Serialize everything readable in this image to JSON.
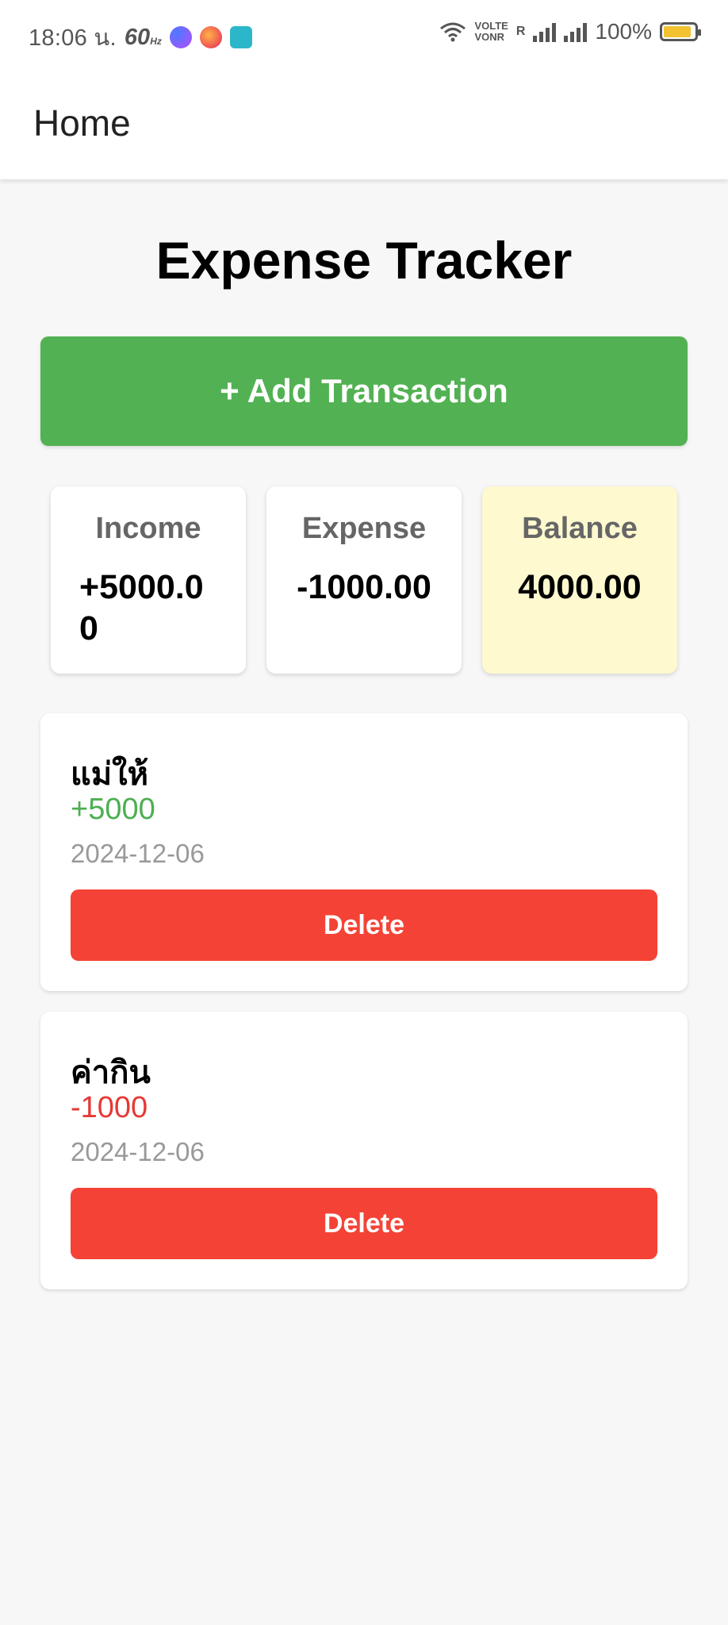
{
  "status_bar": {
    "time": "18:06 น.",
    "refresh_rate": "60",
    "refresh_unit": "Hz",
    "volte": "VOLTE",
    "vonr": "VONR",
    "roaming": "R",
    "battery": "100%",
    "battery_level": 1.0,
    "icons": [
      "messenger-icon",
      "lazada-icon",
      "usb-icon",
      "wifi-icon",
      "signal-icon",
      "battery-icon"
    ]
  },
  "app_bar": {
    "title": "Home"
  },
  "page": {
    "title": "Expense Tracker"
  },
  "add_button": {
    "label": "+ Add Transaction"
  },
  "summary": {
    "income": {
      "label": "Income",
      "value": "+5000.00"
    },
    "expense": {
      "label": "Expense",
      "value": "-1000.00"
    },
    "balance": {
      "label": "Balance",
      "value": "4000.00"
    }
  },
  "transactions": [
    {
      "description": "แม่ให้",
      "amount": "+5000",
      "date": "2024-12-06",
      "delete_label": "Delete",
      "type": "income"
    },
    {
      "description": "ค่ากิน",
      "amount": "-1000",
      "date": "2024-12-06",
      "delete_label": "Delete",
      "type": "expense"
    }
  ],
  "colors": {
    "accent_green": "#52b152",
    "delete_red": "#f44336",
    "income_green": "#4caf50",
    "expense_red": "#e53935",
    "balance_bg": "#fff9cf"
  }
}
